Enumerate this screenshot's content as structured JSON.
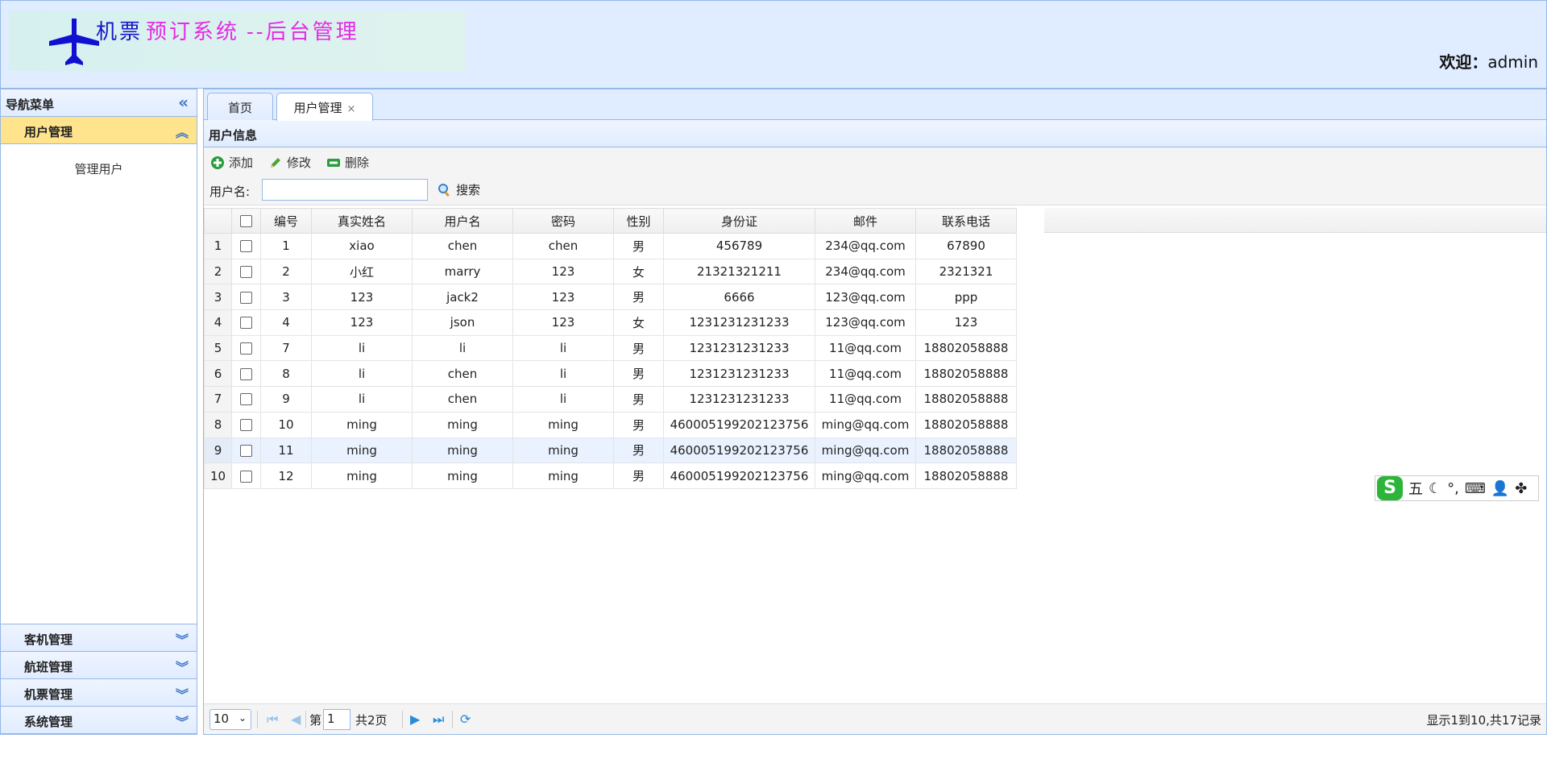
{
  "header": {
    "logo_part1": "机票",
    "logo_part2": "预订系统",
    "logo_part3": "--后台管理",
    "welcome_label": "欢迎：",
    "welcome_user": "admin"
  },
  "nav": {
    "title": "导航菜单",
    "active_section": "用户管理",
    "active_items": [
      "管理用户"
    ],
    "sections": [
      "客机管理",
      "航班管理",
      "机票管理",
      "系统管理"
    ]
  },
  "tabs": [
    {
      "label": "首页"
    },
    {
      "label": "用户管理",
      "close": "×"
    }
  ],
  "panel": {
    "title": "用户信息"
  },
  "toolbar": {
    "add": "添加",
    "edit": "修改",
    "delete": "删除",
    "search_label": "用户名:",
    "search_value": "",
    "search_btn": "搜索"
  },
  "table": {
    "columns": [
      "编号",
      "真实姓名",
      "用户名",
      "密码",
      "性别",
      "身份证",
      "邮件",
      "联系电话"
    ],
    "rows": [
      [
        "1",
        "1",
        "xiao",
        "chen",
        "chen",
        "男",
        "456789",
        "234@qq.com",
        "67890"
      ],
      [
        "2",
        "2",
        "小红",
        "marry",
        "123",
        "女",
        "21321321211",
        "234@qq.com",
        "2321321"
      ],
      [
        "3",
        "3",
        "123",
        "jack2",
        "123",
        "男",
        "6666",
        "123@qq.com",
        "ppp"
      ],
      [
        "4",
        "4",
        "123",
        "json",
        "123",
        "女",
        "1231231231233",
        "123@qq.com",
        "123"
      ],
      [
        "5",
        "7",
        "li",
        "li",
        "li",
        "男",
        "1231231231233",
        "11@qq.com",
        "18802058888"
      ],
      [
        "6",
        "8",
        "li",
        "chen",
        "li",
        "男",
        "1231231231233",
        "11@qq.com",
        "18802058888"
      ],
      [
        "7",
        "9",
        "li",
        "chen",
        "li",
        "男",
        "1231231231233",
        "11@qq.com",
        "18802058888"
      ],
      [
        "8",
        "10",
        "ming",
        "ming",
        "ming",
        "男",
        "460005199202123756",
        "ming@qq.com",
        "18802058888"
      ],
      [
        "9",
        "11",
        "ming",
        "ming",
        "ming",
        "男",
        "460005199202123756",
        "ming@qq.com",
        "18802058888"
      ],
      [
        "10",
        "12",
        "ming",
        "ming",
        "ming",
        "男",
        "460005199202123756",
        "ming@qq.com",
        "18802058888"
      ]
    ],
    "highlighted_row": 9
  },
  "pager": {
    "page_size": "10",
    "page_prefix": "第",
    "page_current": "1",
    "page_total": "共2页",
    "info": "显示1到10,共17记录"
  },
  "ime": {
    "mode": "五",
    "punct": "°,"
  },
  "colors": {
    "header_bg": "#e0ecff",
    "border": "#95b8e7",
    "selected_nav": "#ffe48d",
    "logo_blue": "#1515c8",
    "logo_pink": "#e62ae6"
  }
}
